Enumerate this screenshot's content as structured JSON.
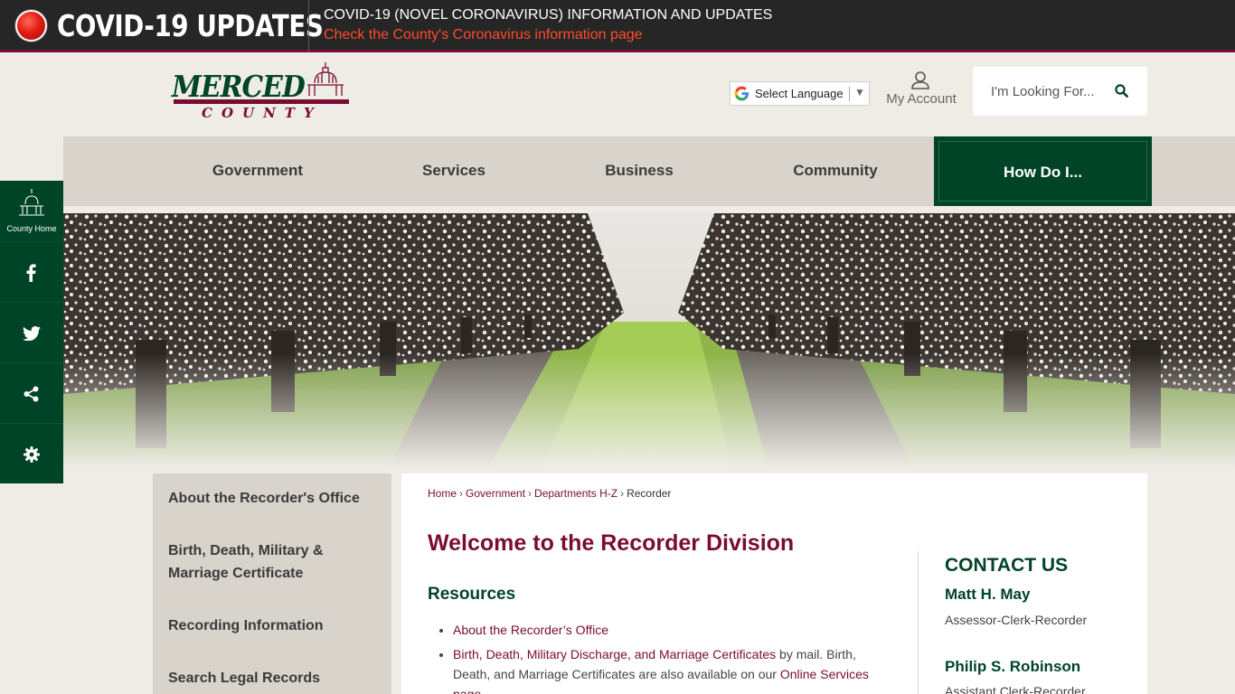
{
  "colors": {
    "brand_green": "#004428",
    "brand_maroon": "#7a0b35",
    "alert_red": "#ff4a2c",
    "banner_bg": "#262626",
    "nav_bg": "#d8d4cc",
    "page_bg": "#efece6"
  },
  "covid": {
    "title": "COVID-19 UPDATES",
    "headline": "COVID-19 (NOVEL CORONAVIRUS) INFORMATION AND UPDATES",
    "link": "Check the County's Coronavirus information page"
  },
  "header": {
    "logo_line1": "MERCED",
    "logo_line2": "COUNTY",
    "language_label": "Select Language",
    "language_arrow": "▼",
    "account_label": "My Account",
    "search_placeholder": "I'm Looking For...",
    "icons": {
      "google": "google-g-icon",
      "account": "user-icon",
      "search": "search-icon"
    }
  },
  "nav": {
    "items": [
      {
        "label": "Government"
      },
      {
        "label": "Services"
      },
      {
        "label": "Business"
      },
      {
        "label": "Community"
      },
      {
        "label": "How Do I..."
      }
    ]
  },
  "rail": {
    "home_label": "County Home",
    "icons": [
      "capitol-icon",
      "facebook-icon",
      "twitter-icon",
      "share-icon",
      "gear-icon"
    ]
  },
  "side_menu": {
    "items": [
      {
        "label": "About the Recorder's Office"
      },
      {
        "label": "Birth, Death, Military & Marriage Certificate"
      },
      {
        "label": "Recording Information"
      },
      {
        "label": "Search Legal Records"
      }
    ]
  },
  "breadcrumb": {
    "items": [
      "Home",
      "Government",
      "Departments H-Z",
      "Recorder"
    ],
    "separator": "›"
  },
  "main": {
    "title": "Welcome to the Recorder Division",
    "resources_title": "Resources",
    "resources": [
      {
        "link": "About the Recorder’s Office"
      },
      {
        "link": "Birth, Death, Military Discharge, and Marriage Certificates",
        "text": " by mail. Birth, Death, and Marriage Certificates are also available on our ",
        "link2": "Online Services page"
      }
    ]
  },
  "contact": {
    "title": "CONTACT US",
    "people": [
      {
        "name": "Matt H. May",
        "role": "Assessor-Clerk-Recorder"
      },
      {
        "name": "Philip S. Robinson",
        "role": "Assistant Clerk-Recorder"
      }
    ]
  }
}
